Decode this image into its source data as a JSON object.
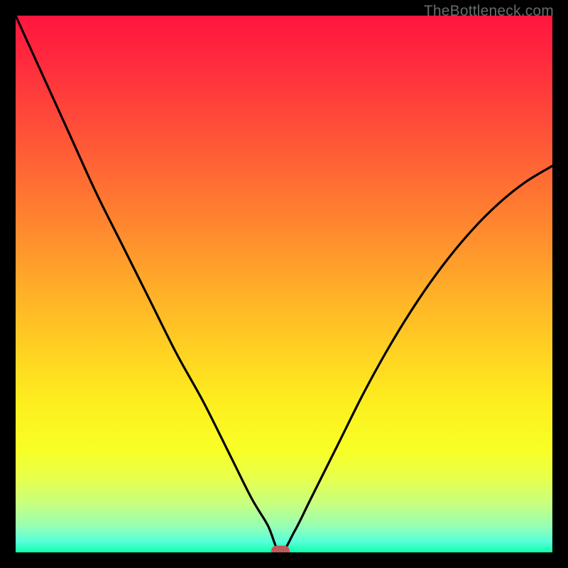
{
  "watermark": "TheBottleneck.com",
  "colors": {
    "frame": "#000000",
    "gradient_top": "#ff153f",
    "gradient_bottom": "#10ffa7",
    "curve": "#000000",
    "marker": "#c05a5a"
  },
  "chart_data": {
    "type": "line",
    "title": "",
    "xlabel": "",
    "ylabel": "",
    "xlim": [
      0,
      100
    ],
    "ylim": [
      0,
      100
    ],
    "series": [
      {
        "name": "bottleneck-curve",
        "x": [
          0,
          5,
          10,
          15,
          20,
          25,
          30,
          35,
          40,
          44,
          47,
          49.3,
          52,
          55,
          60,
          65,
          70,
          75,
          80,
          85,
          90,
          95,
          100
        ],
        "y": [
          100,
          89,
          78,
          67,
          57,
          47,
          37,
          28,
          18,
          10,
          5,
          0,
          4,
          10,
          20,
          30,
          39,
          47,
          54,
          60,
          65,
          69,
          72
        ]
      }
    ],
    "annotations": [
      {
        "name": "optimal-point",
        "x": 49.3,
        "y": 0
      }
    ]
  }
}
